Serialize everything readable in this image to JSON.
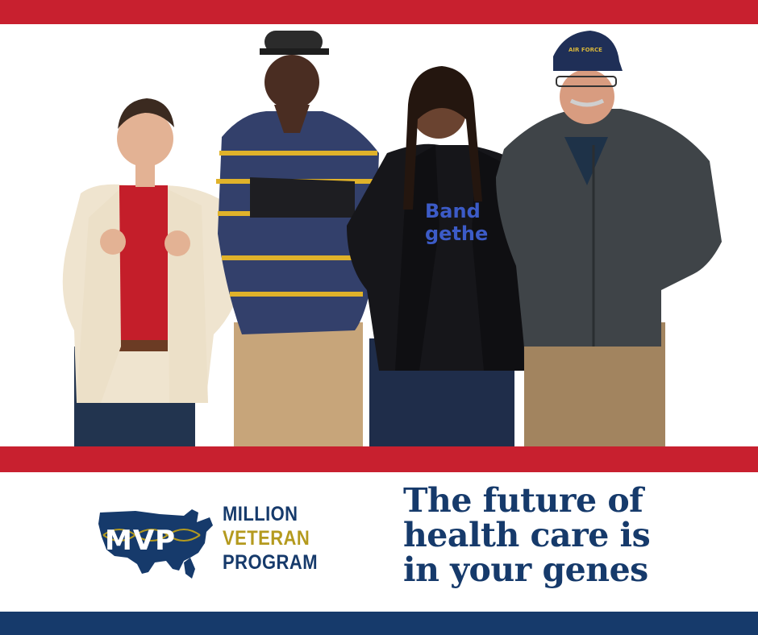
{
  "colors": {
    "red": "#c8202f",
    "navy": "#163a6b",
    "gold": "#b49a1e",
    "white": "#ffffff"
  },
  "logo": {
    "mark_text": "MVP",
    "line1": "MILLION",
    "line2": "VETERAN",
    "line3": "PROGRAM"
  },
  "tagline": {
    "line1": "The future of",
    "line2": "health care is",
    "line3": "in your genes"
  },
  "photo": {
    "shirt_text_line1": "Band",
    "shirt_text_line2": "gethe",
    "cap_text": "AIR FORCE"
  }
}
